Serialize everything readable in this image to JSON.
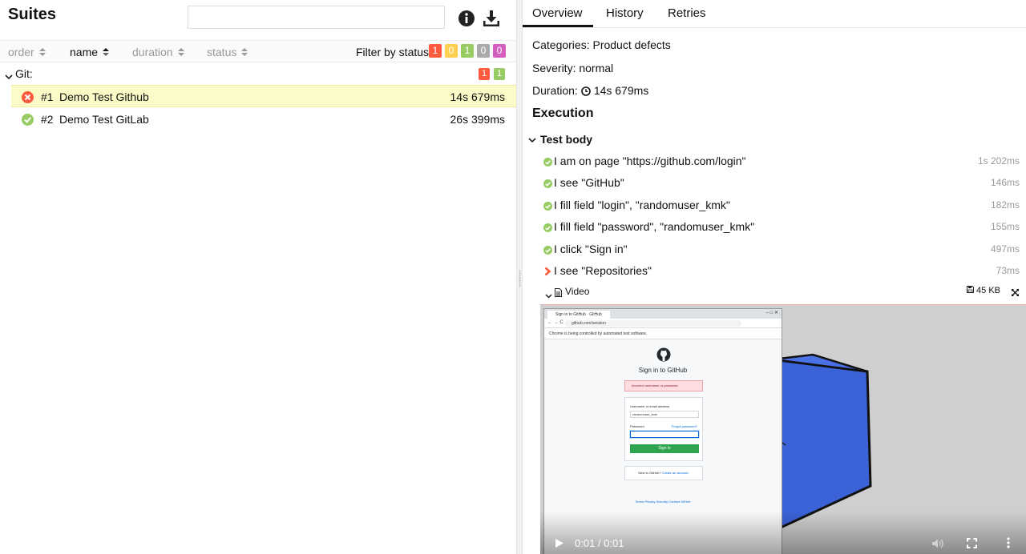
{
  "left": {
    "title": "Suites",
    "search": {
      "value": "",
      "placeholder": ""
    },
    "sort_columns": [
      "order",
      "name",
      "duration",
      "status"
    ],
    "active_sort": "name",
    "filter_label": "Filter by status:",
    "status_badges": [
      {
        "count": "1",
        "color": "#fd5a3e"
      },
      {
        "count": "0",
        "color": "#ffd050"
      },
      {
        "count": "1",
        "color": "#97cc64"
      },
      {
        "count": "0",
        "color": "#aaaaaa"
      },
      {
        "count": "0",
        "color": "#d35ebe"
      }
    ],
    "group": {
      "name": "Git:",
      "badges": [
        {
          "count": "1",
          "color": "#fd5a3e"
        },
        {
          "count": "1",
          "color": "#97cc64"
        }
      ]
    },
    "tests": [
      {
        "num": "#1",
        "name": "Demo Test Github",
        "duration": "14s 679ms",
        "status": "failed"
      },
      {
        "num": "#2",
        "name": "Demo Test GitLab",
        "duration": "26s 399ms",
        "status": "passed"
      }
    ]
  },
  "right": {
    "tabs": [
      "Overview",
      "History",
      "Retries"
    ],
    "active_tab": "Overview",
    "categories": "Categories: Product defects",
    "severity": "Severity: normal",
    "duration_label": "Duration:",
    "duration_value": "14s 679ms",
    "execution_title": "Execution",
    "test_body_label": "Test body",
    "steps": [
      {
        "text": "I am on page \"https://github.com/login\"",
        "duration": "1s 202ms",
        "status": "passed"
      },
      {
        "text": "I see \"GitHub\"",
        "duration": "146ms",
        "status": "passed"
      },
      {
        "text": "I fill field \"login\", \"randomuser_kmk\"",
        "duration": "182ms",
        "status": "passed"
      },
      {
        "text": "I fill field \"password\", \"randomuser_kmk\"",
        "duration": "155ms",
        "status": "passed"
      },
      {
        "text": "I click \"Sign in\"",
        "duration": "497ms",
        "status": "passed"
      },
      {
        "text": "I see \"Repositories\"",
        "duration": "73ms",
        "status": "failed"
      }
    ],
    "attachment": {
      "label": "Video",
      "size": "45 KB"
    },
    "video": {
      "time": "0:01 / 0:01",
      "browser_tab": "Sign in to GitHub · GitHub",
      "browser_url": "github.com/session",
      "browser_info": "Chrome is being controlled by automated test software.",
      "page_title": "Sign in to GitHub",
      "error_text": "Incorrect username or password.",
      "username_label": "Username or email address",
      "username_value": "randomuser_kmk",
      "password_label": "Password",
      "forgot_label": "Forgot password?",
      "signin_label": "Sign in",
      "create_prefix": "New to GitHub?",
      "create_link": "Create an account.",
      "footer": "Terms   Privacy   Security   Contact GitHub"
    }
  },
  "colors": {
    "failed": "#fd5a3e",
    "passed": "#97cc64",
    "selected_row": "#fbfbc8",
    "cube": "#3b62d6"
  }
}
